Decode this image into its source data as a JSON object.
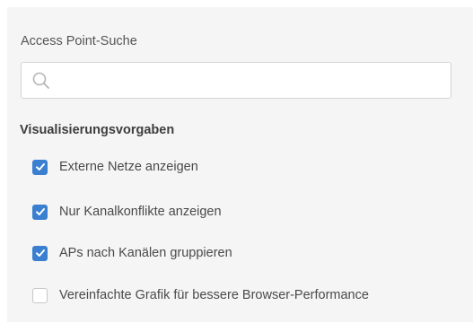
{
  "search": {
    "label": "Access Point-Suche",
    "value": "",
    "placeholder": "",
    "icon": "search-icon"
  },
  "visualization": {
    "title": "Visualisierungsvorgaben",
    "options": [
      {
        "label": "Externe Netze anzeigen",
        "checked": true
      },
      {
        "label": "Nur Kanalkonflikte anzeigen",
        "checked": true
      },
      {
        "label": "APs nach Kanälen gruppieren",
        "checked": true
      },
      {
        "label": "Vereinfachte Grafik für bessere Browser-Performance",
        "checked": false
      }
    ]
  },
  "colors": {
    "accent": "#3a7fd0",
    "panel_background": "#f5f5f5"
  }
}
